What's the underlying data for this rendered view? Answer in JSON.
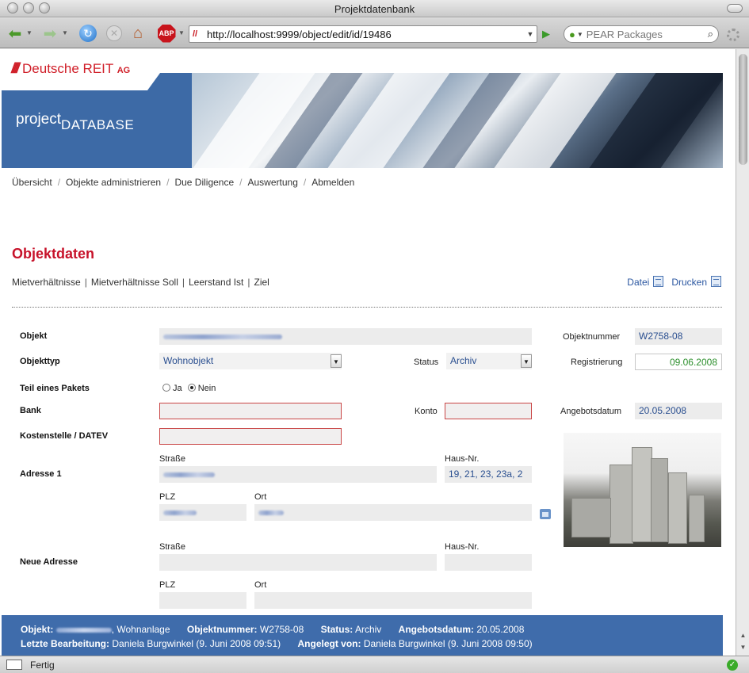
{
  "window": {
    "title": "Projektdatenbank"
  },
  "browser": {
    "url": "http://localhost:9999/object/edit/id/19486",
    "search_placeholder": "PEAR Packages",
    "status_text": "Fertig"
  },
  "brand": {
    "company": "Deutsche REIT",
    "company_suffix": "AG",
    "app_prefix": "project",
    "app_name": "DATABASE"
  },
  "nav": {
    "items": [
      "Übersicht",
      "Objekte administrieren",
      "Due Diligence",
      "Auswertung",
      "Abmelden"
    ],
    "separator": "/"
  },
  "page": {
    "title": "Objektdaten",
    "subnav": [
      "Mietverhältnisse",
      "Mietverhältnisse Soll",
      "Leerstand Ist",
      "Ziel"
    ],
    "subnav_separator": "|",
    "actions": {
      "file": "Datei",
      "print": "Drucken"
    }
  },
  "form": {
    "objekt_label": "Objekt",
    "objekttyp_label": "Objekttyp",
    "objekttyp_value": "Wohnobjekt",
    "status_label": "Status",
    "status_value": "Archiv",
    "paket_label": "Teil eines Pakets",
    "paket_ja": "Ja",
    "paket_nein": "Nein",
    "bank_label": "Bank",
    "konto_label": "Konto",
    "kostenstelle_label": "Kostenstelle / DATEV",
    "adresse1_label": "Adresse 1",
    "neue_adresse_label": "Neue Adresse",
    "strasse_label": "Straße",
    "hausnr_label": "Haus-Nr.",
    "hausnr_value": "19, 21, 23, 23a, 2",
    "plz_label": "PLZ",
    "ort_label": "Ort",
    "objektnummer_label": "Objektnummer",
    "objektnummer_value": "W2758-08",
    "registrierung_label": "Registrierung",
    "registrierung_value": "09.06.2008",
    "angebotsdatum_label": "Angebotsdatum",
    "angebotsdatum_value": "20.05.2008"
  },
  "infobar": {
    "objekt_label": "Objekt:",
    "objekt_type": ", Wohnanlage",
    "objektnummer_label": "Objektnummer:",
    "objektnummer_value": "W2758-08",
    "status_label": "Status:",
    "status_value": "Archiv",
    "angebotsdatum_label": "Angebotsdatum:",
    "angebotsdatum_value": "20.05.2008",
    "letzte_label": "Letzte Bearbeitung:",
    "letzte_value": "Daniela Burgwinkel (9. Juni 2008 09:51)",
    "angelegt_label": "Angelegt von:",
    "angelegt_value": "Daniela Burgwinkel (9. Juni 2008 09:50)"
  },
  "colors": {
    "accent_red": "#c7122a",
    "link_blue": "#2a56a0",
    "banner_blue": "#3d6aa6",
    "footer_blue": "#3f6cab"
  }
}
